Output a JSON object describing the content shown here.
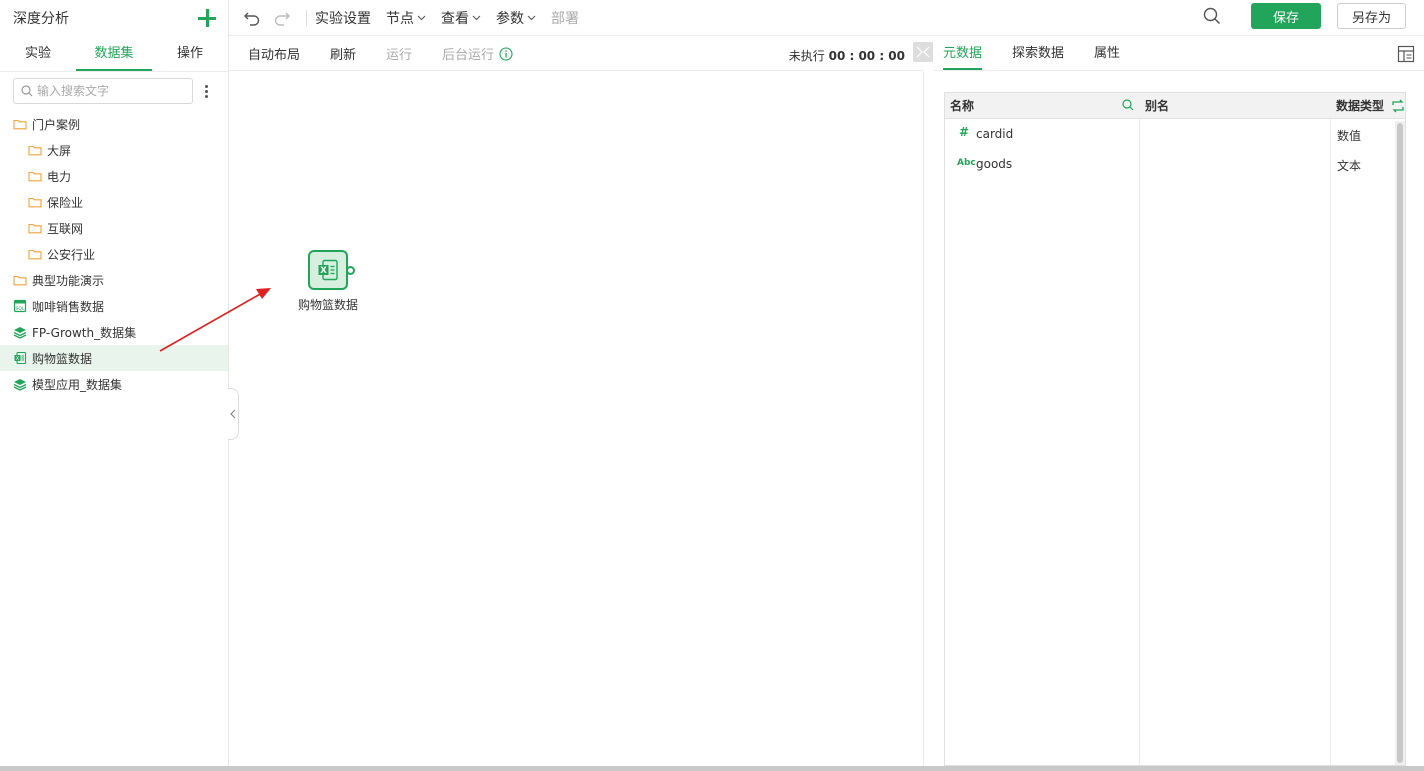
{
  "sidebar": {
    "title": "深度分析",
    "tabs": [
      "实验",
      "数据集",
      "操作"
    ],
    "active_tab": "数据集",
    "search_placeholder": "输入搜索文字",
    "tree": [
      {
        "label": "门户案例",
        "icon": "folder-icon",
        "level": 0
      },
      {
        "label": "大屏",
        "icon": "folder-icon",
        "level": 1
      },
      {
        "label": "电力",
        "icon": "folder-icon",
        "level": 1
      },
      {
        "label": "保险业",
        "icon": "folder-icon",
        "level": 1
      },
      {
        "label": "互联网",
        "icon": "folder-icon",
        "level": 1
      },
      {
        "label": "公安行业",
        "icon": "folder-icon",
        "level": 1
      },
      {
        "label": "典型功能演示",
        "icon": "folder-icon",
        "level": 0
      },
      {
        "label": "咖啡销售数据",
        "icon": "sql-dataset-icon",
        "level": 0
      },
      {
        "label": "FP-Growth_数据集",
        "icon": "stack-dataset-icon",
        "level": 0
      },
      {
        "label": "购物篮数据",
        "icon": "excel-dataset-icon",
        "level": 0,
        "selected": true
      },
      {
        "label": "模型应用_数据集",
        "icon": "stack-dataset-icon",
        "level": 0
      }
    ]
  },
  "toolbar": {
    "menus": [
      {
        "label": "实验设置",
        "dropdown": false,
        "disabled": false
      },
      {
        "label": "节点",
        "dropdown": true,
        "disabled": false
      },
      {
        "label": "查看",
        "dropdown": true,
        "disabled": false
      },
      {
        "label": "参数",
        "dropdown": true,
        "disabled": false
      },
      {
        "label": "部署",
        "dropdown": false,
        "disabled": true
      }
    ],
    "save_label": "保存",
    "save_as_label": "另存为"
  },
  "canvas_bar": {
    "auto_layout": "自动布局",
    "refresh": "刷新",
    "run": "运行",
    "background_run": "后台运行",
    "status_label": "未执行",
    "status_time": "00 : 00 : 00"
  },
  "canvas": {
    "node_label": "购物篮数据"
  },
  "right_panel": {
    "tabs": [
      "元数据",
      "探索数据",
      "属性"
    ],
    "active_tab": "元数据",
    "table": {
      "headers": {
        "name": "名称",
        "alias": "别名",
        "type": "数据类型"
      },
      "rows": [
        {
          "type_icon": "#",
          "name": "cardid",
          "alias": "",
          "type": "数值"
        },
        {
          "type_icon": "Abc",
          "name": "goods",
          "alias": "",
          "type": "文本"
        }
      ]
    }
  },
  "colors": {
    "accent": "#21a55a",
    "folder": "#f0a23b",
    "arrow": "#e02020"
  }
}
